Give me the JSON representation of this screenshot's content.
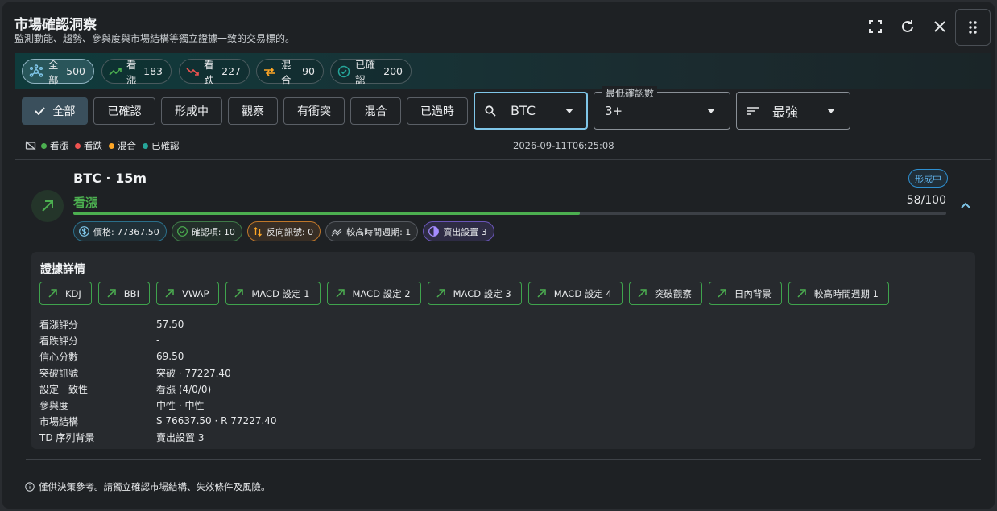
{
  "header": {
    "title": "市場確認洞察",
    "subtitle": "監測動能、趨勢、參與度與市場結構等獨立證據一致的交易標的。"
  },
  "summary": [
    {
      "label": "全部",
      "count": "500",
      "icon": "hub-icon",
      "color": "#7fc6e8"
    },
    {
      "label": "看漲",
      "count": "183",
      "icon": "trending-up-icon",
      "color": "#4caf50"
    },
    {
      "label": "看跌",
      "count": "227",
      "icon": "trending-down-icon",
      "color": "#ef5350"
    },
    {
      "label": "混合",
      "count": "90",
      "icon": "swap-icon",
      "color": "#ffa726"
    },
    {
      "label": "已確認",
      "count": "200",
      "icon": "verified-icon",
      "color": "#26a69a"
    }
  ],
  "filters": [
    "全部",
    "已確認",
    "形成中",
    "觀察",
    "有衝突",
    "混合",
    "已過時"
  ],
  "search": {
    "value": "BTC"
  },
  "min_confirm": {
    "label": "最低確認數",
    "value": "3+"
  },
  "sort": {
    "value": "最強"
  },
  "legend": [
    {
      "label": "看漲",
      "color": "#4caf50"
    },
    {
      "label": "看跌",
      "color": "#ef5350"
    },
    {
      "label": "混合",
      "color": "#ffa726"
    },
    {
      "label": "已確認",
      "color": "#26a69a"
    }
  ],
  "timestamp": "2026-09-11T06:25:08",
  "card": {
    "title": "BTC · 15m",
    "direction": "看漲",
    "status": "形成中",
    "score_text": "58/100",
    "score_fraction": 0.58,
    "chips": [
      {
        "text": "價格: 77367.50",
        "icon": "dollar-icon"
      },
      {
        "text": "確認項: 10",
        "icon": "check-circle-icon"
      },
      {
        "text": "反向訊號: 0",
        "icon": "swap-vert-icon"
      },
      {
        "text": "較高時間週期: 1",
        "icon": "stacked-line-icon"
      },
      {
        "text": "賣出設置 3",
        "icon": "contrast-icon"
      }
    ],
    "evidence": {
      "title": "證據詳情",
      "tags": [
        "KDJ",
        "BBI",
        "VWAP",
        "MACD 設定 1",
        "MACD 設定 2",
        "MACD 設定 3",
        "MACD 設定 4",
        "突破觀察",
        "日內背景",
        "較高時間週期 1"
      ],
      "rows": [
        {
          "k": "看漲評分",
          "v": "57.50"
        },
        {
          "k": "看跌評分",
          "v": "-"
        },
        {
          "k": "信心分數",
          "v": "69.50"
        },
        {
          "k": "突破訊號",
          "v": "突破 · 77227.40"
        },
        {
          "k": "設定一致性",
          "v": "看漲 (4/0/0)"
        },
        {
          "k": "參與度",
          "v": "中性 · 中性"
        },
        {
          "k": "市場結構",
          "v": "S 76637.50 · R 77227.40"
        },
        {
          "k": "TD 序列背景",
          "v": "賣出設置 3"
        }
      ]
    }
  },
  "disclaimer": "僅供決策參考。請獨立確認市場結構、失效條件及風險。"
}
